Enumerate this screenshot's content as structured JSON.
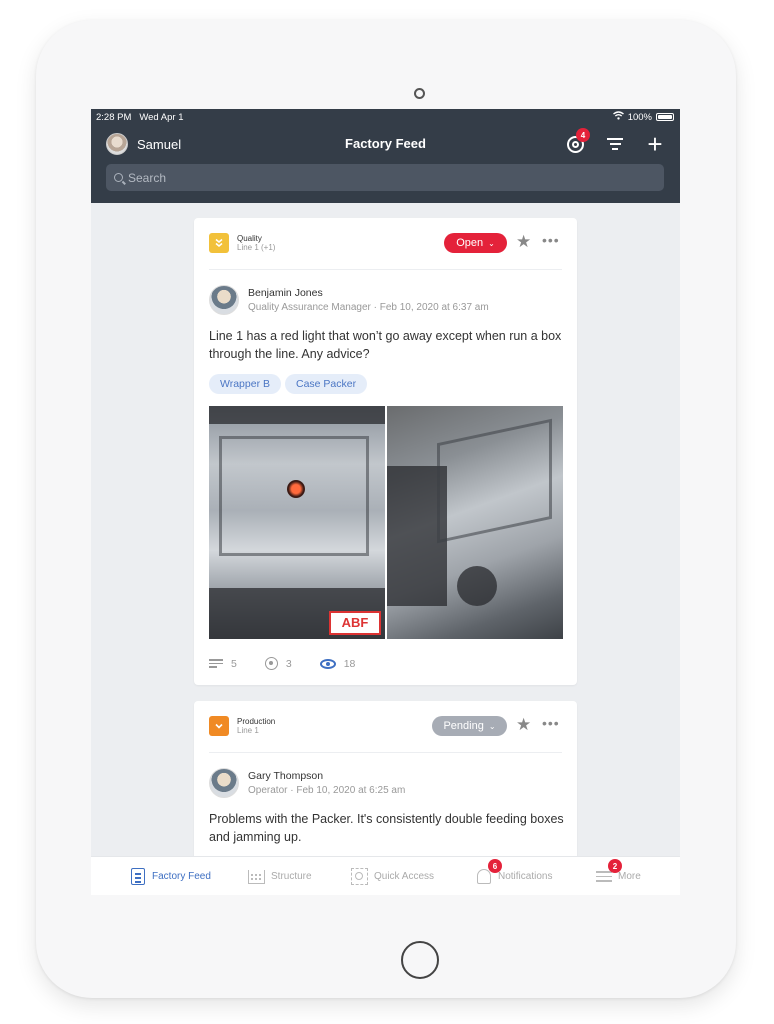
{
  "status_bar": {
    "time": "2:28 PM",
    "date": "Wed Apr 1",
    "battery": "100%"
  },
  "header": {
    "user_name": "Samuel",
    "title": "Factory Feed",
    "support_badge": "4",
    "icons": [
      "lifering-icon",
      "filter-icon",
      "plus-icon"
    ]
  },
  "search": {
    "placeholder": "Search",
    "value": ""
  },
  "posts": [
    {
      "category": "Quality",
      "category_icon": "chevrons-down-icon",
      "category_color": "#f2c13a",
      "line": "Line 1 (+1)",
      "status": "Open",
      "status_color": "#e4223a",
      "author": "Benjamin Jones",
      "meta": "Quality Assurance Manager · Feb 10, 2020 at 6:37 am",
      "text": "Line 1 has a red light that won’t go away except when run a box through the line. Any advice?",
      "tags": [
        "Wrapper B",
        "Case Packer"
      ],
      "photo_logo_text": "ABF",
      "stats": {
        "comments": "5",
        "actions": "3",
        "views": "18"
      }
    },
    {
      "category": "Production",
      "category_icon": "chevron-down-icon",
      "category_color": "#f08a24",
      "line": "Line 1",
      "status": "Pending",
      "status_color": "#a7acb5",
      "author": "Gary Thompson",
      "meta": "Operator · Feb 10, 2020 at 6:25 am",
      "text": "Problems with the Packer. It's consistently double feeding boxes and jamming up."
    }
  ],
  "tab_bar": [
    {
      "label": "Factory Feed",
      "icon": "feed-icon",
      "active": true
    },
    {
      "label": "Structure",
      "icon": "structure-icon"
    },
    {
      "label": "Quick Access",
      "icon": "quick-access-icon"
    },
    {
      "label": "Notifications",
      "icon": "bell-icon",
      "badge": "6"
    },
    {
      "label": "More",
      "icon": "menu-icon",
      "badge": "2"
    }
  ],
  "colors": {
    "header_bg": "#343d48",
    "accent": "#3e6fc2",
    "screen_bg": "#eceef1"
  }
}
